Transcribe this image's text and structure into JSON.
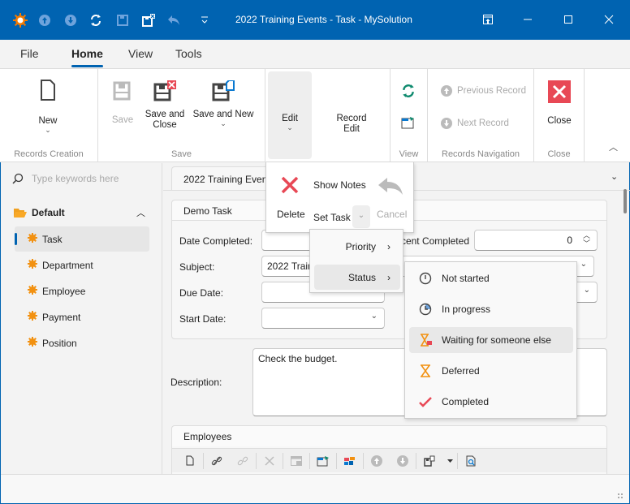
{
  "window": {
    "title": "2022 Training Events - Task - MySolution",
    "quick_access": [
      "app-logo-icon",
      "arrow-up-icon",
      "arrow-down-icon",
      "refresh-icon",
      "save-icon",
      "save-close-icon",
      "undo-icon",
      "customize-icon"
    ],
    "controls": [
      "pin-icon",
      "minimize-icon",
      "maximize-icon",
      "close-icon"
    ]
  },
  "menu": {
    "tabs": [
      {
        "label": "File"
      },
      {
        "label": "Home",
        "active": true
      },
      {
        "label": "View"
      },
      {
        "label": "Tools"
      }
    ]
  },
  "ribbon": {
    "groups": {
      "records_creation": "Records Creation",
      "save": "Save",
      "view": "View",
      "records_navigation": "Records Navigation",
      "close": "Close"
    },
    "new_label": "New",
    "save_label": "Save",
    "save_close_label": "Save and Close",
    "save_new_label": "Save and New",
    "edit_label": "Edit",
    "record_edit_label": "Record Edit",
    "previous_record": "Previous Record",
    "next_record": "Next Record",
    "close_label": "Close"
  },
  "edit_menu": {
    "delete": "Delete",
    "show_notes": "Show Notes",
    "set_task": "Set Task",
    "cancel": "Cancel"
  },
  "set_task_menu": {
    "items": [
      {
        "label": "Priority"
      },
      {
        "label": "Status",
        "highlighted": true
      }
    ]
  },
  "status_menu": {
    "items": [
      {
        "label": "Not started",
        "icon": "clock-icon"
      },
      {
        "label": "In progress",
        "icon": "progress-clock-icon"
      },
      {
        "label": "Waiting for someone else",
        "icon": "hourglass-flag-icon",
        "highlighted": true
      },
      {
        "label": "Deferred",
        "icon": "hourglass-icon"
      },
      {
        "label": "Completed",
        "icon": "checkmark-icon"
      }
    ]
  },
  "sidebar": {
    "search_placeholder": "Type keywords here",
    "group_label": "Default",
    "items": [
      {
        "label": "Task",
        "selected": true
      },
      {
        "label": "Department"
      },
      {
        "label": "Employee"
      },
      {
        "label": "Payment"
      },
      {
        "label": "Position"
      }
    ]
  },
  "document_tab": {
    "label": "2022 Training Events"
  },
  "form": {
    "panel_title": "Demo Task",
    "date_completed_label": "Date Completed:",
    "subject_label": "Subject:",
    "subject_value": "2022 Training Events",
    "due_date_label": "Due Date:",
    "start_date_label": "Start Date:",
    "percent_completed_label": "Percent Completed:",
    "percent_completed_value": "0",
    "description_label": "Description:",
    "description_value": "Check the budget."
  },
  "employees": {
    "title": "Employees"
  }
}
